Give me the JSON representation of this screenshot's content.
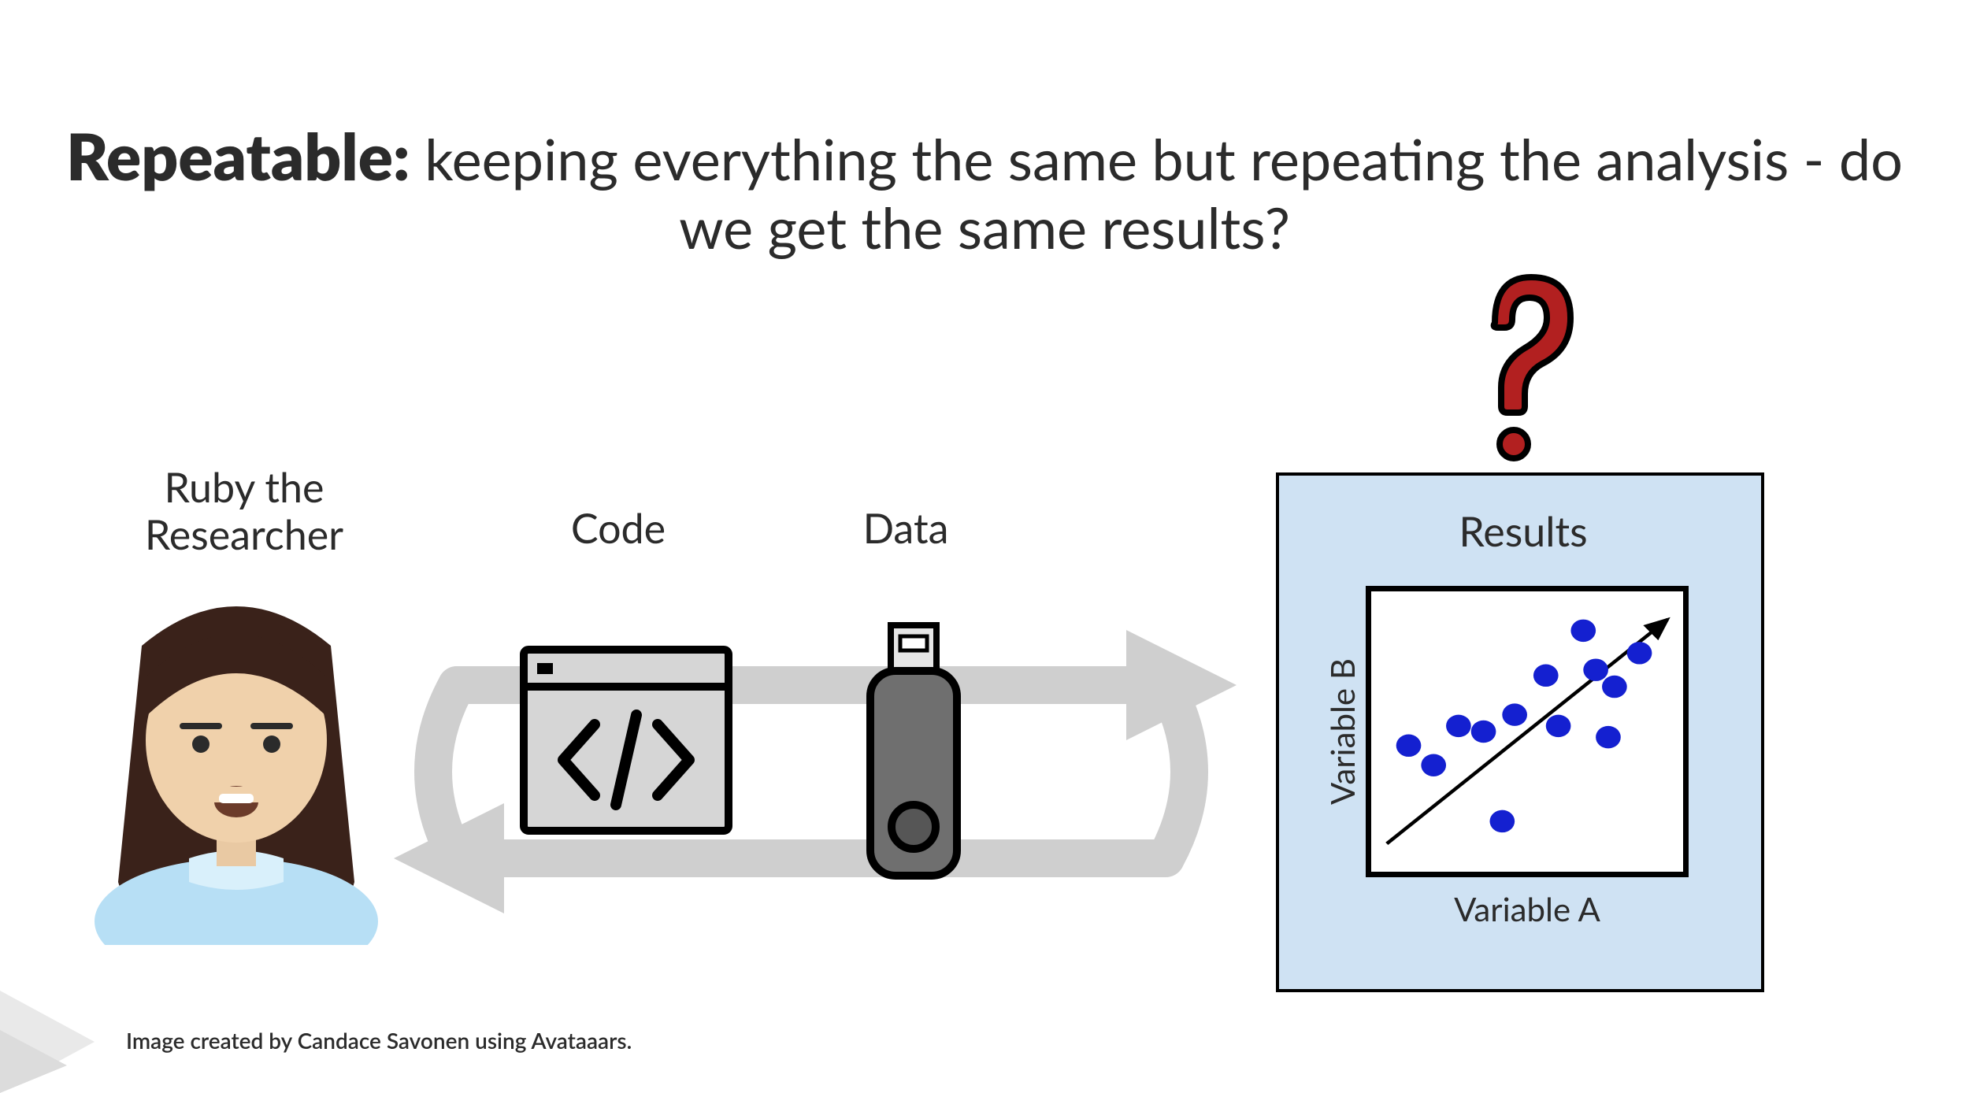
{
  "title_bold": "Repeatable:",
  "title_rest": " keeping everything the same but repeating the analysis - do we get the same results?",
  "labels": {
    "researcher": "Ruby the Researcher",
    "code": "Code",
    "data": "Data",
    "results": "Results",
    "xaxis": "Variable A",
    "yaxis": "Variable B"
  },
  "credit": "Image created by Candace Savonen using Avataaars.",
  "chart_data": {
    "type": "scatter",
    "title": "Results",
    "xlabel": "Variable A",
    "ylabel": "Variable B",
    "xlim": [
      0,
      10
    ],
    "ylim": [
      0,
      10
    ],
    "trend": {
      "x0": 0.5,
      "y0": 1,
      "x1": 9.5,
      "y1": 9
    },
    "series": [
      {
        "name": "points",
        "x": [
          1.2,
          2.0,
          2.8,
          3.6,
          4.2,
          4.6,
          5.6,
          6.0,
          6.8,
          7.2,
          7.6,
          7.8,
          8.6
        ],
        "y": [
          4.5,
          3.8,
          5.2,
          5.0,
          1.8,
          5.6,
          7.0,
          5.2,
          8.6,
          7.2,
          4.8,
          6.6,
          7.8
        ]
      }
    ]
  }
}
